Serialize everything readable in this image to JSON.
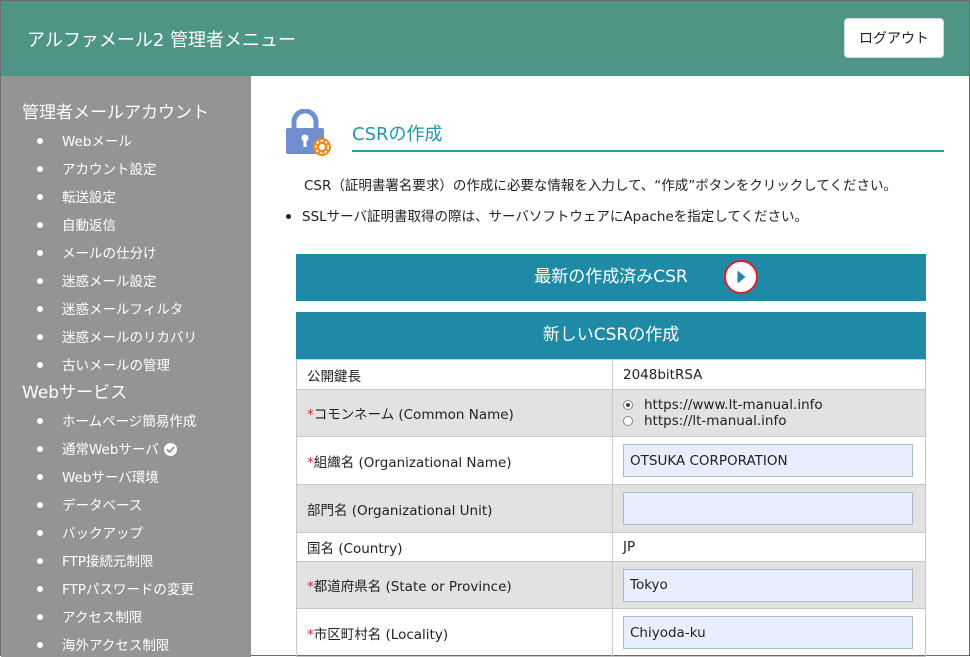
{
  "header": {
    "title": "アルファメール2 管理者メニュー",
    "logout_label": "ログアウト"
  },
  "sidebar": {
    "sections": [
      {
        "title": "管理者メールアカウント",
        "items": [
          "Webメール",
          "アカウント設定",
          "転送設定",
          "自動返信",
          "メールの仕分け",
          "迷惑メール設定",
          "迷惑メールフィルタ",
          "迷惑メールのリカバリ",
          "古いメールの管理"
        ]
      },
      {
        "title": "Webサービス",
        "items": [
          "ホームページ簡易作成",
          "通常Webサーバ",
          "Webサーバ環境",
          "データベース",
          "バックアップ",
          "FTP接続元制限",
          "FTPパスワードの変更",
          "アクセス制限",
          "海外アクセス制限"
        ]
      }
    ]
  },
  "main": {
    "page_title": "CSRの作成",
    "description": "CSR（証明書署名要求）の作成に必要な情報を入力して、“作成”ボタンをクリックしてください。",
    "note": "SSLサーバ証明書取得の際は、サーバソフトウェアにApacheを指定してください。",
    "latest_csr_label": "最新の作成済みCSR",
    "new_csr_label": "新しいCSRの作成",
    "required_mark": "*",
    "form": {
      "key_length": {
        "label": "公開鍵長",
        "value": "2048bitRSA"
      },
      "common_name": {
        "label": "コモンネーム (Common Name)",
        "options": [
          "https://www.lt-manual.info",
          "https://lt-manual.info"
        ],
        "selected": "https://www.lt-manual.info"
      },
      "organization": {
        "label": "組織名 (Organizational Name)",
        "value": "OTSUKA CORPORATION"
      },
      "unit": {
        "label": "部門名 (Organizational Unit)",
        "value": ""
      },
      "country": {
        "label": "国名 (Country)",
        "value": "JP"
      },
      "state": {
        "label": "都道府県名 (State or Province)",
        "value": "Tokyo"
      },
      "locality": {
        "label": "市区町村名 (Locality)",
        "value": "Chiyoda-ku"
      }
    }
  },
  "colors": {
    "header": "#4e9585",
    "sidebar": "#949494",
    "accent": "#1e8aa6",
    "highlight_ring": "#d9232b"
  }
}
